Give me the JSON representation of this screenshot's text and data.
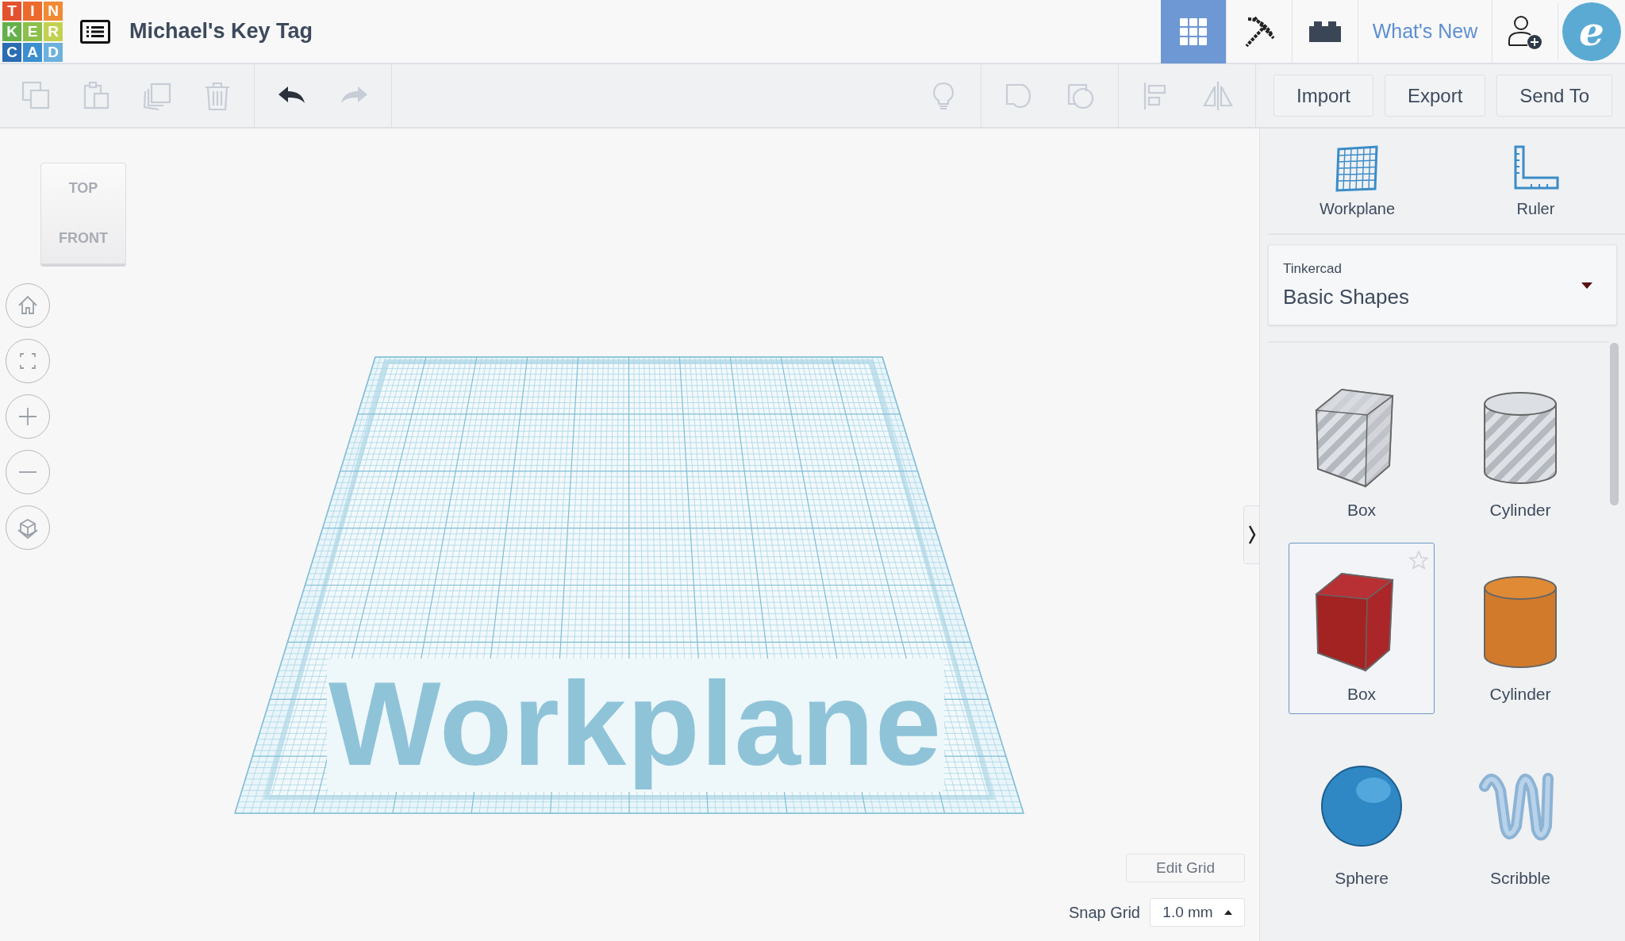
{
  "logo": [
    {
      "letter": "T",
      "color": "#e4512f"
    },
    {
      "letter": "I",
      "color": "#ec6a2c"
    },
    {
      "letter": "N",
      "color": "#f28a33"
    },
    {
      "letter": "K",
      "color": "#65b04a"
    },
    {
      "letter": "E",
      "color": "#8cc04b"
    },
    {
      "letter": "R",
      "color": "#c3d150"
    },
    {
      "letter": "C",
      "color": "#2b6cb2"
    },
    {
      "letter": "A",
      "color": "#3b8fd0"
    },
    {
      "letter": "D",
      "color": "#6cb1dd"
    }
  ],
  "project_title": "Michael's Key Tag",
  "views": [
    {
      "kind": "grid",
      "selected": true
    },
    {
      "kind": "pickaxe",
      "selected": false
    },
    {
      "kind": "brick",
      "selected": false
    }
  ],
  "whats_new": "What's New",
  "avatar": {
    "letter": "e"
  },
  "toolbar": {
    "edit_tools": [
      {
        "kind": "copy",
        "disabled": true
      },
      {
        "kind": "paste",
        "disabled": true
      },
      {
        "kind": "duplicate",
        "disabled": true
      },
      {
        "kind": "delete",
        "disabled": true
      }
    ],
    "history_tools": [
      {
        "kind": "undo",
        "disabled": false
      },
      {
        "kind": "redo",
        "disabled": true
      }
    ],
    "note_tools": [
      {
        "kind": "note",
        "disabled": true
      }
    ],
    "group_tools": [
      {
        "kind": "solid",
        "disabled": true
      },
      {
        "kind": "hole",
        "disabled": true
      }
    ],
    "arrange_tools": [
      {
        "kind": "align",
        "disabled": true
      },
      {
        "kind": "mirror",
        "disabled": true
      }
    ],
    "buttons": [
      "Import",
      "Export",
      "Send To"
    ]
  },
  "view_cube": {
    "top": "TOP",
    "front": "FRONT"
  },
  "nav_controls": [
    {
      "kind": "home"
    },
    {
      "kind": "fit"
    },
    {
      "kind": "zoom_in"
    },
    {
      "kind": "zoom_out"
    },
    {
      "kind": "perspective"
    }
  ],
  "workplane_label": "Workplane",
  "edit_grid": "Edit Grid",
  "snap_grid": {
    "label": "Snap Grid",
    "value": "1.0 mm"
  },
  "panel": {
    "tools": [
      {
        "kind": "workplane",
        "label": "Workplane"
      },
      {
        "kind": "ruler",
        "label": "Ruler"
      }
    ],
    "library": {
      "source": "Tinkercad",
      "name": "Basic Shapes"
    },
    "shapes": [
      {
        "kind": "box_hole",
        "label": "Box",
        "selected": false
      },
      {
        "kind": "cylinder_hole",
        "label": "Cylinder",
        "selected": false
      },
      {
        "kind": "box",
        "label": "Box",
        "selected": true
      },
      {
        "kind": "cylinder",
        "label": "Cylinder",
        "selected": false
      },
      {
        "kind": "sphere",
        "label": "Sphere",
        "selected": false
      },
      {
        "kind": "scribble",
        "label": "Scribble",
        "selected": false
      }
    ]
  }
}
